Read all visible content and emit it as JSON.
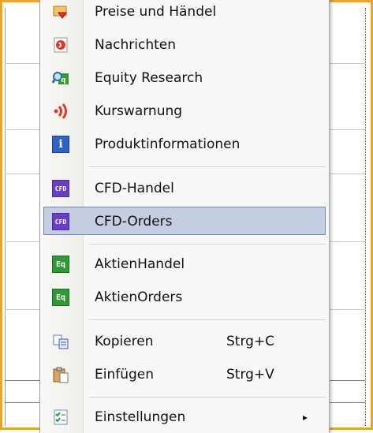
{
  "menu": {
    "items": [
      {
        "label": "Preise und Händel",
        "icon": "price-trading-icon"
      },
      {
        "label": "Nachrichten",
        "icon": "news-icon"
      },
      {
        "label": "Equity Research",
        "icon": "equity-research-icon"
      },
      {
        "label": "Kurswarnung",
        "icon": "price-alert-icon"
      },
      {
        "label": "Produktinformationen",
        "icon": "info-icon"
      },
      {
        "label": "CFD-Handel",
        "icon": "cfd-icon"
      },
      {
        "label": "CFD-Orders",
        "icon": "cfd-icon",
        "selected": true
      },
      {
        "label": "AktienHandel",
        "icon": "eq-icon"
      },
      {
        "label": "AktienOrders",
        "icon": "eq-icon"
      },
      {
        "label": "Kopieren",
        "shortcut": "Strg+C",
        "icon": "copy-icon"
      },
      {
        "label": "Einfügen",
        "shortcut": "Strg+V",
        "icon": "paste-icon"
      },
      {
        "label": "Einstellungen",
        "icon": "settings-icon",
        "submenu_arrow": "▸"
      }
    ],
    "badges": {
      "cfd": "CFD",
      "eq": "Eq",
      "info": "i"
    }
  },
  "colors": {
    "frame": "#e8a52a",
    "highlight": "#c4cde2",
    "highlight_border": "#6f85b6"
  }
}
